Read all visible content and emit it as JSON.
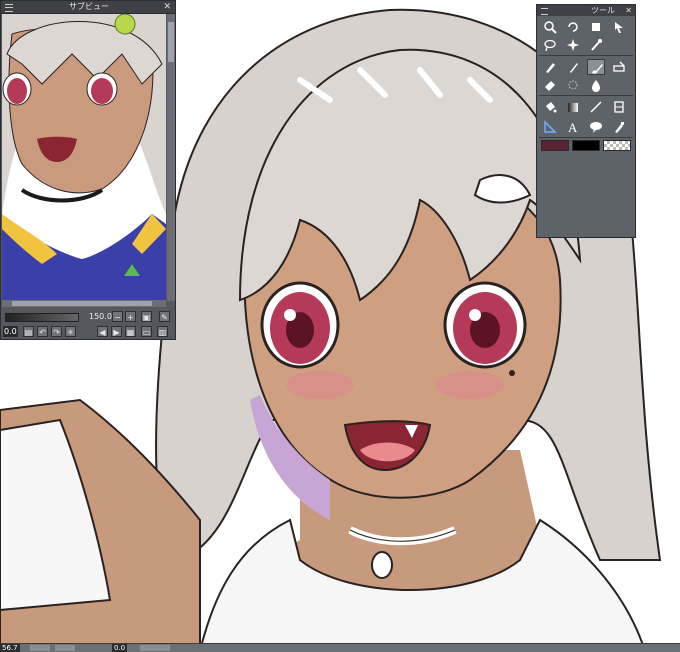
{
  "subview": {
    "title": "サブビュー",
    "zoom_value": "150.0",
    "rotation_value": "0.0"
  },
  "tools": {
    "title": "ツール",
    "items": [
      {
        "name": "zoom-tool"
      },
      {
        "name": "rotate-tool"
      },
      {
        "name": "operation-tool"
      },
      {
        "name": "move-layer-tool"
      },
      {
        "name": "selection-tool"
      },
      {
        "name": "auto-select-tool"
      },
      {
        "name": "eyedropper-tool"
      },
      {
        "name": "pen-tool"
      },
      {
        "name": "pencil-tool"
      },
      {
        "name": "brush-tool"
      },
      {
        "name": "decoration-tool"
      },
      {
        "name": "eraser-tool"
      },
      {
        "name": "blend-tool"
      },
      {
        "name": "airbrush-tool"
      },
      {
        "name": "fill-tool"
      },
      {
        "name": "gradient-tool"
      },
      {
        "name": "figure-tool"
      },
      {
        "name": "frame-tool"
      },
      {
        "name": "ruler-tool"
      },
      {
        "name": "text-tool"
      },
      {
        "name": "balloon-tool"
      },
      {
        "name": "correction-tool"
      }
    ],
    "main_color": "#5a2434",
    "sub_color": "#000000"
  },
  "statusbar": {
    "zoom": "56.7",
    "angle": "0.0"
  }
}
